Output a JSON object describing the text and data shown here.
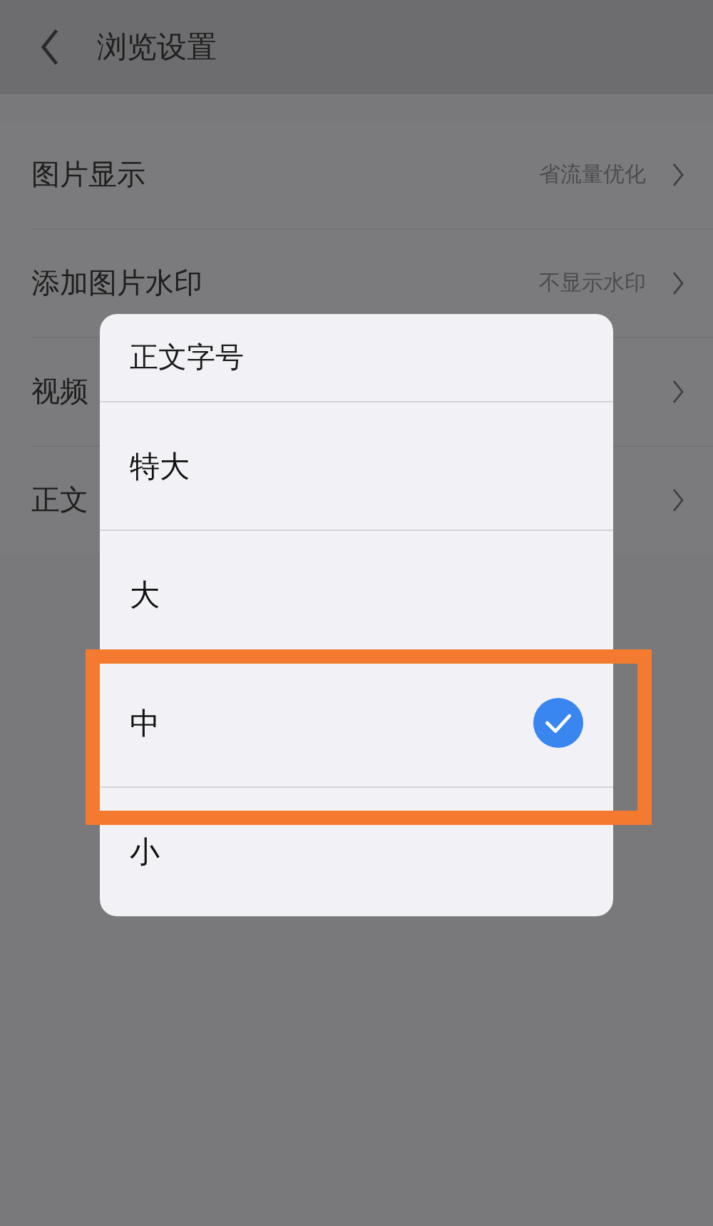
{
  "header": {
    "title": "浏览设置"
  },
  "settings": [
    {
      "label": "图片显示",
      "value": "省流量优化"
    },
    {
      "label": "添加图片水印",
      "value": "不显示水印"
    },
    {
      "label": "视频"
    },
    {
      "label": "正文"
    }
  ],
  "dialog": {
    "title": "正文字号",
    "options": [
      {
        "label": "特大",
        "selected": false,
        "highlighted": false
      },
      {
        "label": "大",
        "selected": false,
        "highlighted": false
      },
      {
        "label": "中",
        "selected": true,
        "highlighted": true
      },
      {
        "label": "小",
        "selected": false,
        "highlighted": false
      }
    ]
  }
}
